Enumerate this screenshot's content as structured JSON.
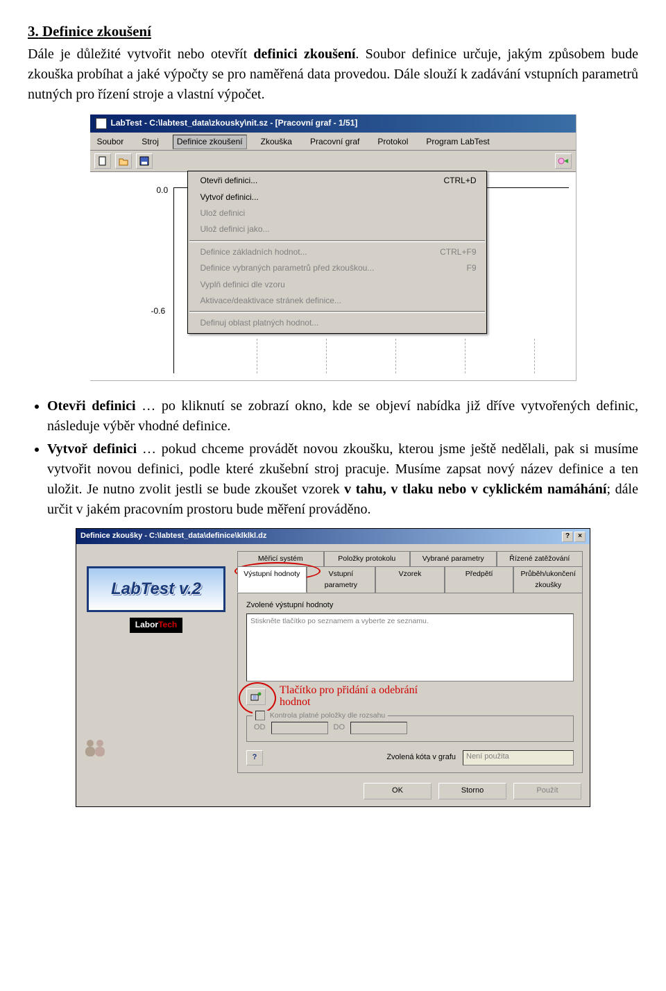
{
  "doc": {
    "heading_prefix": "3.",
    "heading": "Definice zkoušení",
    "para1_a": "Dále je důležité vytvořit nebo otevřít ",
    "para1_b": "definici zkoušení",
    "para1_c": ". Soubor definice určuje, jakým způsobem bude zkouška probíhat a jaké výpočty se pro naměřená data provedou. Dále slouží k zadávání vstupních parametrů nutných pro řízení stroje a vlastní výpočet.",
    "bullet1_a": "Otevři definici",
    "bullet1_b": " … po kliknutí se zobrazí okno, kde se objeví nabídka již dříve vytvořených definic, následuje výběr vhodné definice.",
    "bullet2_a": "Vytvoř definici",
    "bullet2_b": " … pokud chceme provádět novou zkoušku, kterou jsme ještě nedělali, pak si musíme vytvořit novou definici, podle které zkušební stroj pracuje. Musíme zapsat nový název definice a ten uložit. Je nutno zvolit jestli se bude zkoušet vzorek ",
    "bullet2_c": "v tahu, v tlaku nebo v cyklickém namáhání",
    "bullet2_d": "; dále určit v jakém pracovním prostoru bude měření prováděno."
  },
  "shot1": {
    "title": "LabTest - C:\\labtest_data\\zkousky\\nit.sz - [Pracovní graf - 1/51]",
    "menu": {
      "soubor": "Soubor",
      "stroj": "Stroj",
      "definice": "Definice zkoušení",
      "zkouska": "Zkouška",
      "graf": "Pracovní graf",
      "protokol": "Protokol",
      "program": "Program LabTest"
    },
    "axis": {
      "y1": "0.0",
      "y2": "-0.6"
    },
    "dd": {
      "otevri": {
        "label": "Otevři definici...",
        "sc": "CTRL+D"
      },
      "vytvor": {
        "label": "Vytvoř definici..."
      },
      "uloz": {
        "label": "Ulož definici"
      },
      "ulozjako": {
        "label": "Ulož definici jako..."
      },
      "zaklad": {
        "label": "Definice základních hodnot...",
        "sc": "CTRL+F9"
      },
      "vybr": {
        "label": "Definice vybraných parametrů před zkouškou...",
        "sc": "F9"
      },
      "vypln": {
        "label": "Vyplň definici dle vzoru"
      },
      "aktiv": {
        "label": "Aktivace/deaktivace stránek definice..."
      },
      "oblast": {
        "label": "Definuj oblast platných hodnot..."
      }
    }
  },
  "shot2": {
    "title": "Definice zkoušky - C:\\labtest_data\\definice\\klklkl.dz",
    "tabs_row1": {
      "a": "Měřicí systém",
      "b": "Položky protokolu",
      "c": "Vybrané parametry",
      "d": "Řízené zatěžování"
    },
    "tabs_row2": {
      "a": "Výstupní hodnoty",
      "b": "Vstupní parametry",
      "c": "Vzorek",
      "d": "Předpětí",
      "e": "Průběh/ukončení zkoušky"
    },
    "logo": "LabTest v.2",
    "labortech_a": "Labor",
    "labortech_b": "Tech",
    "zvol_label": "Zvolené výstupní hodnoty",
    "listbox_hint": "Stiskněte tlačítko po seznamem a vyberte ze seznamu.",
    "annotation": "Tlačítko pro přidání a odebrání hodnot",
    "group": {
      "title": "Kontrola platné položky dle rozsahu",
      "od": "OD",
      "do": "DO"
    },
    "kota_label": "Zvolená kóta v grafu",
    "kota_value": "Není použita",
    "buttons": {
      "ok": "OK",
      "storno": "Storno",
      "pouzit": "Použít"
    }
  }
}
